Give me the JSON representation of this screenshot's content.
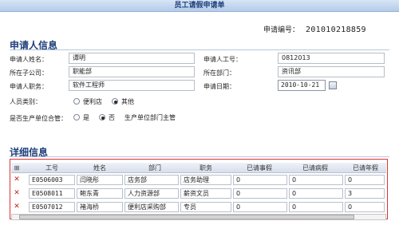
{
  "title": "员工请假申请单",
  "app_no": {
    "label": "申请编号：",
    "value": "201010218859"
  },
  "applicant": {
    "section_title": "申请人信息",
    "name_label": "申请人姓名：",
    "name": "谭明",
    "empno_label": "申请人工号：",
    "empno": "0812013",
    "company_label": "所在子公司：",
    "company": "职能部",
    "dept_label": "所在部门：",
    "dept": "资讯部",
    "position_label": "申请人职务：",
    "position": "软件工程师",
    "date_label": "申请日期：",
    "date": "2010-10-21",
    "category_label": "人员类别：",
    "category_options": [
      "便利店",
      "其他"
    ],
    "category_selected": "其他",
    "prod_label": "是否生产单位合管：",
    "prod_options": [
      "是",
      "否"
    ],
    "prod_selected": "否",
    "prod_note": "生产单位部门主管"
  },
  "detail": {
    "section_title": "详细信息",
    "add_symbol": "⊞",
    "columns": [
      "工号",
      "姓名",
      "部门",
      "职务",
      "已请事假",
      "已请病假",
      "已请年假"
    ],
    "rows": [
      {
        "empno": "E0506003",
        "name": "闫晓彤",
        "dept": "店务部",
        "position": "店务助理",
        "personal": "0",
        "sick": "0",
        "annual": "0"
      },
      {
        "empno": "E0508011",
        "name": "鲍东青",
        "dept": "人力资源部",
        "position": "薪资文员",
        "personal": "0",
        "sick": "0",
        "annual": "3"
      },
      {
        "empno": "E0507012",
        "name": "褚海桥",
        "dept": "便利店采购部",
        "position": "专员",
        "personal": "0",
        "sick": "0",
        "annual": "0"
      }
    ],
    "delete_symbol": "✕"
  },
  "colors": {
    "accent": "#1f3f7a",
    "delete": "#c0281c",
    "detail_border": "#dd3333"
  }
}
